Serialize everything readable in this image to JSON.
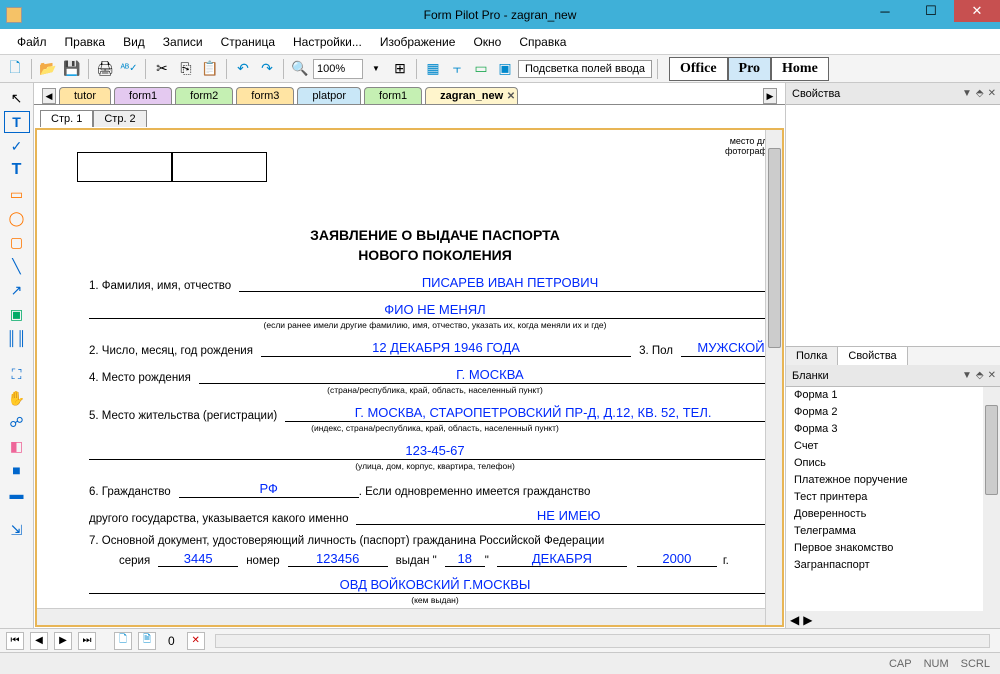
{
  "window": {
    "title": "Form Pilot Pro - zagran_new"
  },
  "menu": {
    "items": [
      "Файл",
      "Правка",
      "Вид",
      "Записи",
      "Страница",
      "Настройки...",
      "Изображение",
      "Окно",
      "Справка"
    ]
  },
  "toolbar": {
    "zoom": "100%",
    "highlight": "Подсветка полей ввода"
  },
  "ribbon": {
    "office": "Office",
    "pro": "Pro",
    "home": "Home"
  },
  "doctabs": [
    {
      "label": "tutor",
      "cls": "",
      "active": false
    },
    {
      "label": "form1",
      "cls": "p",
      "active": false
    },
    {
      "label": "form2",
      "cls": "g",
      "active": false
    },
    {
      "label": "form3",
      "cls": "",
      "active": false
    },
    {
      "label": "platpor",
      "cls": "b",
      "active": false
    },
    {
      "label": "form1",
      "cls": "g",
      "active": false
    },
    {
      "label": "zagran_new",
      "cls": "active",
      "active": true
    }
  ],
  "pagetabs": {
    "p1": "Стр. 1",
    "p2": "Стр. 2"
  },
  "props": {
    "title": "Свойства",
    "tab_shelf": "Полка",
    "tab_props": "Свойства"
  },
  "blanks": {
    "title": "Бланки",
    "items": [
      "Форма 1",
      "Форма 2",
      "Форма 3",
      "Счет",
      "Опись",
      "Платежное поручение",
      "Тест принтера",
      "Доверенность",
      "Телеграмма",
      "Первое знакомство",
      "Загранпаспорт"
    ]
  },
  "status": {
    "cap": "CAP",
    "num": "NUM",
    "scrl": "SCRL"
  },
  "nav": {
    "page": "0"
  },
  "form": {
    "photo": "место для фотографии",
    "title1": "ЗАЯВЛЕНИЕ О ВЫДАЧЕ ПАСПОРТА",
    "title2": "НОВОГО ПОКОЛЕНИЯ",
    "l1": "1. Фамилия, имя, отчество",
    "v1": "ПИСАРЕВ ИВАН ПЕТРОВИЧ",
    "v1b": "ФИО НЕ МЕНЯЛ",
    "h1": "(если ранее имели другие фамилию, имя, отчество, указать их, когда меняли их и где)",
    "l2": "2. Число, месяц, год рождения",
    "v2": "12 ДЕКАБРЯ 1946 ГОДА",
    "l2b": "3. Пол",
    "v2b": "МУЖСКОЙ",
    "l3": "4. Место рождения",
    "v3": "Г. МОСКВА",
    "h3": "(страна/республика, край, область, населенный пункт)",
    "l4": "5. Место жительства (регистрации)",
    "v4": "Г. МОСКВА, СТАРОПЕТРОВСКИЙ ПР-Д, Д.12, КВ. 52, ТЕЛ.",
    "h4": "(индекс, страна/республика, край, область, населенный пункт)",
    "v4b": "123-45-67",
    "h4b": "(улица, дом, корпус, квартира, телефон)",
    "l5": "6. Гражданство",
    "v5": "РФ",
    "l5b": ". Если одновременно имеется гражданство",
    "l5c": "другого государства, указывается какого именно",
    "v5c": "НЕ ИМЕЮ",
    "l6": "7. Основной документ, удостоверяющий личность (паспорт) гражданина Российской Федерации",
    "l6a": "серия",
    "v6a": "3445",
    "l6b": "номер",
    "v6b": "123456",
    "l6c": "выдан \"",
    "v6c": "18",
    "l6d": "\"",
    "v6d": "ДЕКАБРЯ",
    "v6e": "2000",
    "l6e": "г.",
    "v6f": "ОВД ВОЙКОВСКИЙ Г.МОСКВЫ",
    "h6": "(кем выдан)"
  }
}
